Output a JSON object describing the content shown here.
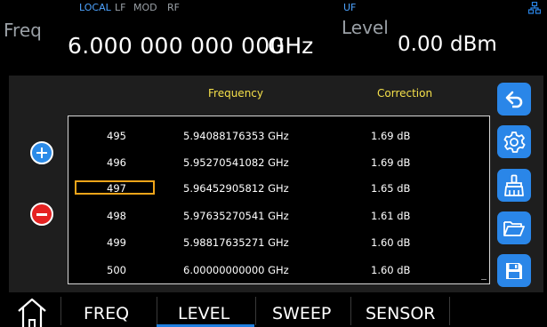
{
  "header": {
    "status_local": "LOCAL",
    "status_lf": "LF",
    "status_mod": "MOD",
    "status_rf": "RF",
    "status_uf": "UF",
    "freq_label": "Freq",
    "freq_value": "6.000 000 000 000",
    "freq_unit": "GHz",
    "level_label": "Level",
    "level_value": "0.00",
    "level_unit": "dBm"
  },
  "table": {
    "col_frequency": "Frequency",
    "col_correction": "Correction",
    "rows": [
      {
        "index": "495",
        "frequency": "5.94088176353 GHz",
        "correction": "1.69 dB"
      },
      {
        "index": "496",
        "frequency": "5.95270541082 GHz",
        "correction": "1.69 dB"
      },
      {
        "index": "497",
        "frequency": "5.96452905812 GHz",
        "correction": "1.65 dB"
      },
      {
        "index": "498",
        "frequency": "5.97635270541 GHz",
        "correction": "1.61 dB"
      },
      {
        "index": "499",
        "frequency": "5.98817635271 GHz",
        "correction": "1.60 dB"
      },
      {
        "index": "500",
        "frequency": "6.00000000000 GHz",
        "correction": "1.60 dB"
      }
    ]
  },
  "side_buttons": [
    "back-icon",
    "settings-gear-icon",
    "clear-broom-icon",
    "open-folder-icon",
    "save-disk-icon"
  ],
  "nav": {
    "tab_freq": "FREQ",
    "tab_level": "LEVEL",
    "tab_sweep": "SWEEP",
    "tab_sensor": "SENSOR",
    "active_tab": "LEVEL"
  },
  "colors": {
    "accent_blue": "#2a86e8",
    "header_yellow": "#f5e04a",
    "selection_orange": "#f0a51a",
    "remove_red": "#e52222"
  }
}
